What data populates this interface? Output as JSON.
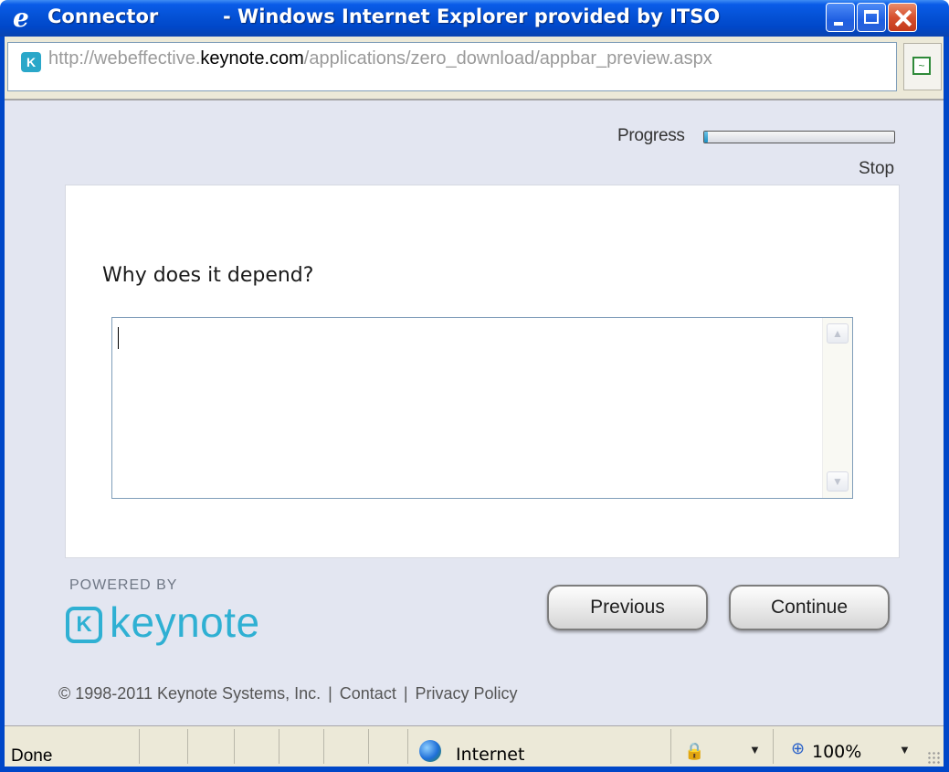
{
  "window": {
    "app_name": "Connector",
    "title_rest": "- Windows Internet Explorer provided by ITSO"
  },
  "address": {
    "url_prefix": "http://webeffective.",
    "url_domain": "keynote.com",
    "url_suffix": "/applications/zero_download/appbar_preview.aspx"
  },
  "survey": {
    "progress_label": "Progress",
    "progress_fraction": 0.02,
    "stop_label": "Stop",
    "question": "Why does it depend?",
    "answer_value": "",
    "previous_label": "Previous",
    "continue_label": "Continue"
  },
  "branding": {
    "powered_by": "POWERED BY",
    "logo_text": "keynote",
    "logo_mark": "K",
    "accent_color": "#2fb0d3"
  },
  "footer": {
    "copyright": "© 1998-2011 Keynote Systems, Inc.",
    "contact": "Contact",
    "privacy": "Privacy Policy",
    "separator": "|"
  },
  "statusbar": {
    "status": "Done",
    "zone": "Internet",
    "zoom": "100%"
  },
  "icons": {
    "ie": "ie-logo-icon",
    "favicon": "keynote-favicon-icon",
    "compat": "compatibility-view-icon",
    "globe": "internet-globe-icon",
    "protected": "protected-mode-icon",
    "zoom": "zoom-icon"
  }
}
